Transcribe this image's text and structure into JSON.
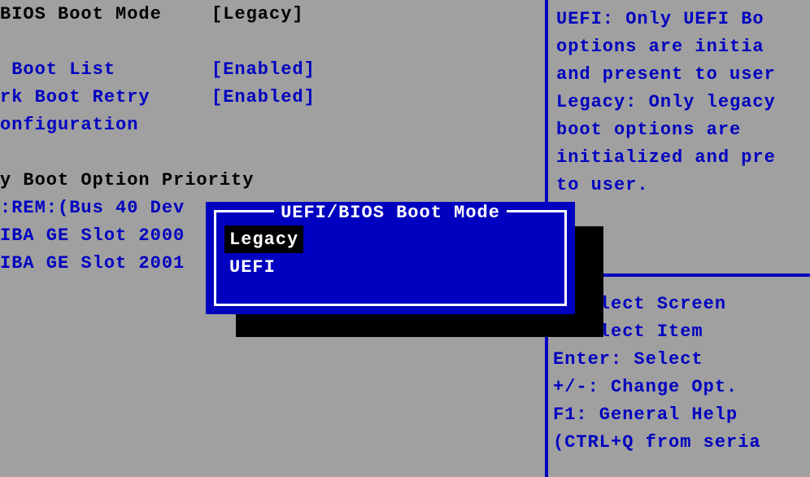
{
  "settings": {
    "boot_mode": {
      "label": "BIOS Boot Mode",
      "value": "[Legacy]"
    },
    "boot_list": {
      "label": " Boot List",
      "value": "[Enabled]"
    },
    "boot_retry": {
      "label": "rk Boot Retry",
      "value": "[Enabled]"
    },
    "configuration": {
      "label": "onfiguration",
      "value": ""
    }
  },
  "priority_header": "y Boot Option Priority",
  "priority_items": [
    ":REM:(Bus 40 Dev",
    "IBA GE Slot 2000",
    "IBA GE Slot 2001"
  ],
  "popup": {
    "title": " UEFI/BIOS Boot Mode ",
    "options": [
      "Legacy",
      "UEFI"
    ],
    "selected": 0
  },
  "help_top": [
    "UEFI: Only UEFI Bo",
    "options are initia",
    "and present to user",
    "Legacy: Only legacy",
    "boot options are",
    "initialized and pre",
    "to user."
  ],
  "help_bottom": [
    "  Select Screen",
    "  Select Item",
    "Enter: Select",
    "+/-: Change Opt.",
    "F1: General Help",
    "(CTRL+Q from seria"
  ]
}
